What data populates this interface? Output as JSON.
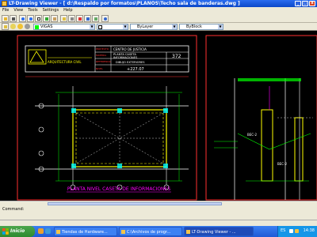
{
  "window": {
    "title": "LT-Drawing Viewer - [ d:\\Respaldo por formatos\\PLANOS\\Techo sala de banderas.dwg ]",
    "controls": {
      "minimize": "_",
      "maximize": "□",
      "close": "x"
    }
  },
  "menu": {
    "items": [
      "File",
      "View",
      "Tools",
      "Settings",
      "Help"
    ]
  },
  "toolbar": {
    "layer_combo": "VIGAS",
    "linetype_combo": "ByLayer",
    "lineweight_combo": "ByBlock",
    "layer_color": "#00ff00"
  },
  "drawing": {
    "title_block": {
      "project_label": "PROYECTO",
      "project_value": "CENTRO DE JUSTICIA",
      "subject_label": "MATERIA",
      "subject_value_line1": "PLANTA CASETA",
      "subject_value_line2": "INFORMACIONES",
      "reference_label": "REFERENCIA",
      "reference_value": "DIBUJO EXTERIORES",
      "sheet_number": "372",
      "level_label": "NIVEL",
      "level_value": "+227.07",
      "firm_caption": "ARQUITECTURA CIVIL"
    },
    "plan_title": "PLANTA NIVEL CASETA DE INFORMACIONES",
    "section_labels": [
      "BEC-2",
      "BEC-2"
    ]
  },
  "status": {
    "command": "Command:"
  },
  "taskbar": {
    "start": "Inicio",
    "tasks": [
      {
        "label": "Tiendas de Hardware..."
      },
      {
        "label": "C:\\Archivos de progr..."
      },
      {
        "label": "LT-Drawing Viewer - ..."
      }
    ],
    "clock": "14:38",
    "language": "ES"
  },
  "colors": {
    "titlebar": "#0b47c8",
    "chrome": "#ece9d8",
    "canvas": "#000000",
    "cad_yellow": "#ffff00",
    "cad_white": "#ffffff",
    "cad_magenta": "#ff00ff",
    "cad_green": "#00ff00",
    "cad_cyan": "#00ffff",
    "cad_red": "#ff3030",
    "taskbar": "#1f5ad6",
    "start": "#2e8a2e"
  }
}
